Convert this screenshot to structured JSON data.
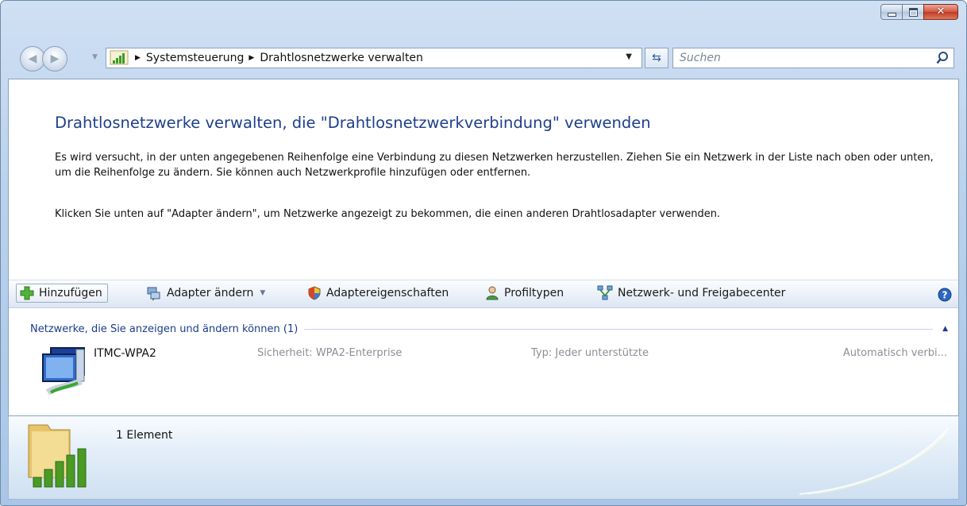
{
  "window": {
    "caption_buttons": {
      "minimize": "minimize-icon",
      "maximize": "maximize-icon",
      "close": "close-icon"
    }
  },
  "navigation": {
    "breadcrumb": [
      "Systemsteuerung",
      "Drahtlosnetzwerke verwalten"
    ],
    "search_placeholder": "Suchen"
  },
  "content": {
    "title": "Drahtlosnetzwerke verwalten, die \"Drahtlosnetzwerkverbindung\" verwenden",
    "paragraph1": "Es wird versucht, in der unten angegebenen Reihenfolge eine Verbindung zu diesen Netzwerken herzustellen. Ziehen Sie ein Netzwerk in der Liste nach oben oder unten, um die Reihenfolge zu ändern. Sie können auch Netzwerkprofile hinzufügen oder entfernen.",
    "paragraph2": "Klicken Sie unten auf \"Adapter ändern\", um Netzwerke angezeigt zu bekommen, die einen anderen Drahtlosadapter verwenden."
  },
  "toolbar": {
    "add": "Hinzufügen",
    "change_adapter": "Adapter ändern",
    "adapter_properties": "Adaptereigenschaften",
    "profile_types": "Profiltypen",
    "network_center": "Netzwerk- und Freigabecenter"
  },
  "network_list": {
    "group_header": "Netzwerke, die Sie anzeigen und ändern können (1)",
    "items": [
      {
        "name": "ITMC-WPA2",
        "security": "Sicherheit: WPA2-Enterprise",
        "type": "Typ: Jeder unterstützte",
        "mode": "Automatisch verbi..."
      }
    ]
  },
  "details": {
    "count": "1 Element"
  },
  "colors": {
    "title_blue": "#1e3f8a",
    "link_blue": "#1c3d8c",
    "secondary_text": "#8a8f96"
  }
}
